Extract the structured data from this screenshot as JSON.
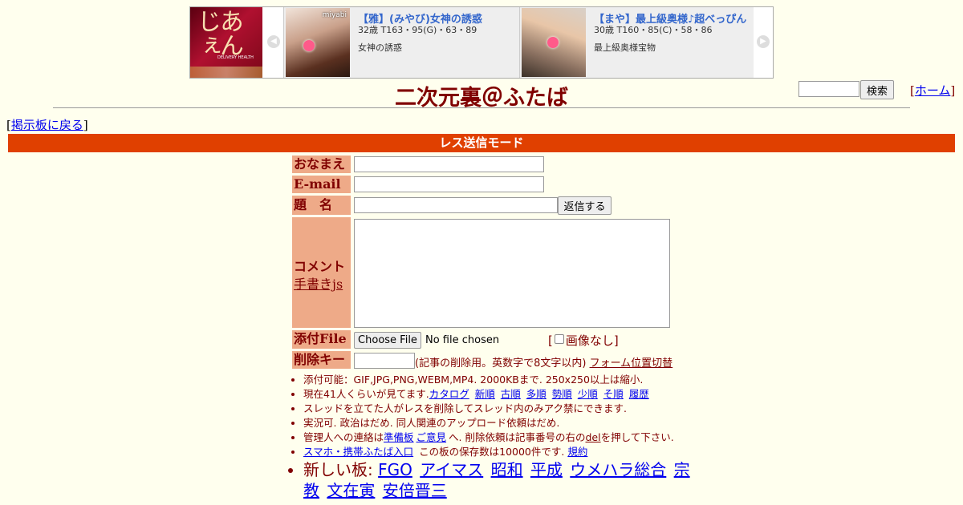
{
  "ad": {
    "logo": {
      "text": "あんじぇ",
      "sub": "DELIVERY HEALTH"
    },
    "cards": [
      {
        "name": "【雅】(みやび)女神の誘惑",
        "spec": "32歳 T163・95(G)・63・89",
        "desc": "女神の誘惑",
        "mark": "miyabi"
      },
      {
        "name": "【まや】最上級奥様♪超べっぴん",
        "spec": "30歳 T160・85(C)・58・86",
        "desc": "最上級奥様宝物",
        "mark": ""
      }
    ]
  },
  "header": {
    "title": "二次元裏＠ふたば",
    "search_button": "検索",
    "home_link": "ホーム"
  },
  "nav": {
    "back_link": "掲示板に戻る"
  },
  "mode_bar": "レス送信モード",
  "form": {
    "name_label": "おなまえ",
    "email_label": "E-mail",
    "subject_label": "題　名",
    "submit_button": "返信する",
    "comment_label": "コメント",
    "handwrite_link": "手書きjs",
    "file_label": "添付File",
    "choose_file_button": "Choose File",
    "no_file_text": "No file chosen",
    "no_image_label": "画像なし",
    "delkey_label": "削除キー",
    "delkey_note": "(記事の削除用。英数字で8文字以内)",
    "form_toggle_link": "フォーム位置切替"
  },
  "notes": {
    "line1": "添付可能：GIF,JPG,PNG,WEBM,MP4. 2000KBまで. 250x250以上は縮小.",
    "line2_prefix": "現在41人くらいが見てます.",
    "line2_links": [
      "カタログ",
      "新順",
      "古順",
      "多順",
      "勢順",
      "少順",
      "そ順",
      "履歴"
    ],
    "line3": "スレッドを立てた人がレスを削除してスレッド内のみアク禁にできます.",
    "line4": "実況可. 政治はだめ. 同人関連のアップロード依頼はだめ.",
    "line5_prefix": "管理人への連絡は",
    "line5_link1": "準備板",
    "line5_link2": "ご意見",
    "line5_mid": "へ. 削除依頼は記事番号の右の",
    "line5_del": "del",
    "line5_suffix": "を押して下さい.",
    "line6_link": "スマホ・携帯ふたば入口",
    "line6_mid": " この板の保存数は10000件です.",
    "line6_link2": "規約",
    "line7_prefix": "新しい板:",
    "line7_links": [
      "FGO",
      "アイマス",
      "昭和",
      "平成",
      "ウメハラ総合",
      "宗教",
      "文在寅",
      "安倍晋三"
    ]
  }
}
